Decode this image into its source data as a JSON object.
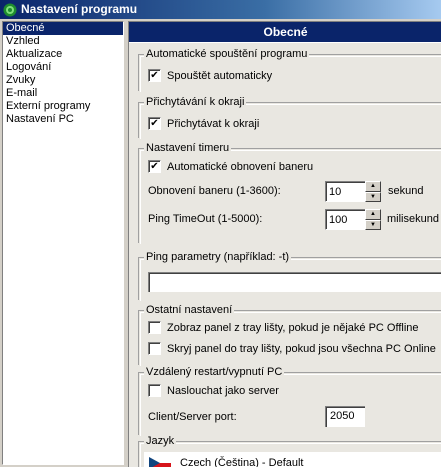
{
  "window": {
    "title": "Nastavení programu"
  },
  "nav": {
    "items": [
      {
        "label": "Obecné",
        "selected": true
      },
      {
        "label": "Vzhled"
      },
      {
        "label": "Aktualizace"
      },
      {
        "label": "Logování"
      },
      {
        "label": "Zvuky"
      },
      {
        "label": "E-mail"
      },
      {
        "label": "Externí programy"
      },
      {
        "label": "Nastavení PC"
      }
    ]
  },
  "panel": {
    "title": "Obecné"
  },
  "autostart": {
    "legend": "Automatické spouštění programu",
    "checkbox_label": "Spouštět automaticky",
    "checked": true
  },
  "snap": {
    "legend": "Přichytávání k okraji",
    "checkbox_label": "Přichytávat k okraji",
    "checked": true
  },
  "timer": {
    "legend": "Nastavení timeru",
    "auto_refresh_label": "Automatické obnovení baneru",
    "auto_refresh_checked": true,
    "refresh_label": "Obnovení baneru (1-3600):",
    "refresh_value": "10",
    "refresh_unit": "sekund",
    "ping_timeout_label": "Ping TimeOut (1-5000):",
    "ping_timeout_value": "100",
    "ping_timeout_unit": "milisekund"
  },
  "ping": {
    "legend": "Ping parametry (například: -t)",
    "value": ""
  },
  "other": {
    "legend": "Ostatní nastavení",
    "show_panel_label": "Zobraz panel z tray lišty, pokud je nějaké PC Offline",
    "show_panel_checked": false,
    "hide_panel_label": "Skryj panel do tray lišty, pokud jsou všechna PC Online",
    "hide_panel_checked": false
  },
  "remote": {
    "legend": "Vzdálený restart/vypnutí PC",
    "listen_label": "Naslouchat jako server",
    "listen_checked": false,
    "port_label": "Client/Server port:",
    "port_value": "2050"
  },
  "language": {
    "legend": "Jazyk",
    "selected": "Czech (Čeština) - Default",
    "flag_icon": "czech-flag-icon"
  },
  "colors": {
    "accent": "#0a246a",
    "panel_bg": "#e9e7e1",
    "window_bg": "#d4d0c8"
  }
}
